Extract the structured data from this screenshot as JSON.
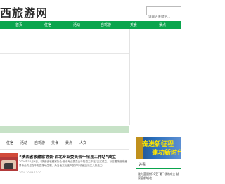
{
  "header": {
    "logo": "西旅游网",
    "search_placeholder": "请输入关键字..."
  },
  "nav": {
    "items": [
      "首页",
      "住宿",
      "活动",
      "自驾游",
      "美食",
      "景点"
    ]
  },
  "tabs": {
    "items": [
      "住宿",
      "活动",
      "自驾游",
      "美食",
      "景点",
      "人文"
    ]
  },
  "article": {
    "title": "“陕西省收藏家协会·西北专业委员会千阳县工作站”成立",
    "summary": "2024年10月9日，“陕西省收藏家协会·西北专业委员会千阳县工作站”正式成立，标志着陕西收藏界专业力量在千阳县落地生根，为当地文化遗产保护与收藏交流注入新活力。",
    "meta": "2024-10-09 13:20"
  },
  "ad": {
    "line1": "奋进新征程",
    "line2": "建功新时代"
  },
  "sidebar": {
    "title": "必看",
    "item": "陇为蓝面街10受“最”领先成全 就家庭前城北"
  },
  "colors": {
    "nav_bg": "#0aa54d",
    "green_bar": "#c7e2c7"
  }
}
